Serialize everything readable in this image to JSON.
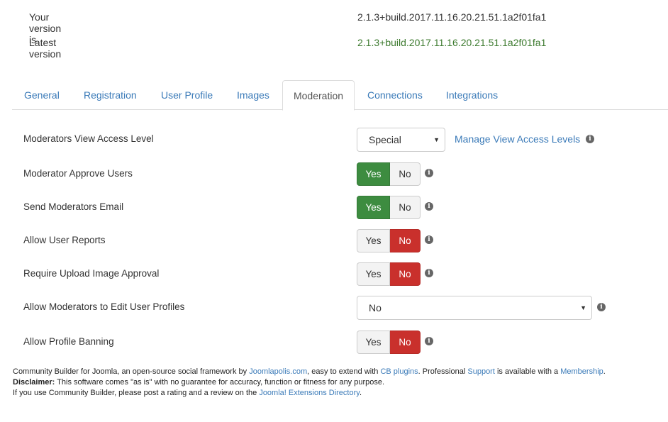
{
  "version": {
    "current_label": "Your version is",
    "current_value": "2.1.3+build.2017.11.16.20.21.51.1a2f01fa1",
    "latest_label": "Latest version",
    "latest_value": "2.1.3+build.2017.11.16.20.21.51.1a2f01fa1"
  },
  "tabs": [
    {
      "label": "General"
    },
    {
      "label": "Registration"
    },
    {
      "label": "User Profile"
    },
    {
      "label": "Images"
    },
    {
      "label": "Moderation"
    },
    {
      "label": "Connections"
    },
    {
      "label": "Integrations"
    }
  ],
  "active_tab": "Moderation",
  "settings": {
    "view_access_level": {
      "label": "Moderators View Access Level",
      "value": "Special",
      "link": "Manage View Access Levels"
    },
    "approve_users": {
      "label": "Moderator Approve Users",
      "yes": "Yes",
      "no": "No",
      "selected": "Yes"
    },
    "send_email": {
      "label": "Send Moderators Email",
      "yes": "Yes",
      "no": "No",
      "selected": "Yes"
    },
    "user_reports": {
      "label": "Allow User Reports",
      "yes": "Yes",
      "no": "No",
      "selected": "No"
    },
    "image_approval": {
      "label": "Require Upload Image Approval",
      "yes": "Yes",
      "no": "No",
      "selected": "No"
    },
    "edit_profiles": {
      "label": "Allow Moderators to Edit User Profiles",
      "value": "No"
    },
    "profile_banning": {
      "label": "Allow Profile Banning",
      "yes": "Yes",
      "no": "No",
      "selected": "No"
    }
  },
  "footer": {
    "line1_a": "Community Builder for Joomla, an open-source social framework by ",
    "line1_link1": "Joomlapolis.com",
    "line1_b": ", easy to extend with ",
    "line1_link2": "CB plugins",
    "line1_c": ". Professional ",
    "line1_link3": "Support",
    "line1_d": " is available with a ",
    "line1_link4": "Membership",
    "line1_e": ".",
    "line2_bold": "Disclaimer:",
    "line2_text": " This software comes \"as is\" with no guarantee for accuracy, function or fitness for any purpose.",
    "line3_a": "If you use Community Builder, please post a rating and a review on the ",
    "line3_link": "Joomla! Extensions Directory",
    "line3_b": "."
  },
  "colors": {
    "accent": "#3a7ab8",
    "yes_on": "#3d8c40",
    "no_on": "#c9302c",
    "latest": "#3c7a2e"
  },
  "icons": [
    "info-icon",
    "chevron-down-icon"
  ]
}
